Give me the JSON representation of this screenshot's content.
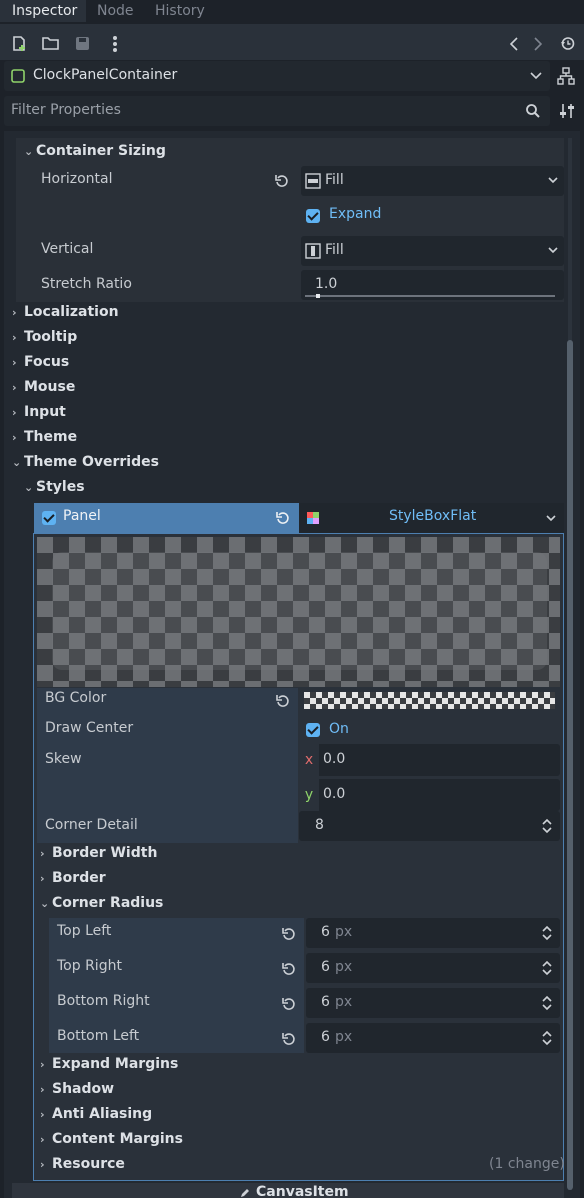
{
  "tabs": [
    {
      "label": "Inspector",
      "active": true
    },
    {
      "label": "Node",
      "active": false
    },
    {
      "label": "History",
      "active": false
    }
  ],
  "node_selector": {
    "value": "ClockPanelContainer"
  },
  "filter": {
    "placeholder": "Filter Properties"
  },
  "container_sizing": {
    "title": "Container Sizing",
    "horizontal_label": "Horizontal",
    "horizontal_value": "Fill",
    "expand_label": "Expand",
    "vertical_label": "Vertical",
    "vertical_value": "Fill",
    "stretch_label": "Stretch Ratio",
    "stretch_value": "1.0"
  },
  "sections": {
    "localization": "Localization",
    "tooltip": "Tooltip",
    "focus": "Focus",
    "mouse": "Mouse",
    "input": "Input",
    "theme": "Theme",
    "theme_overrides": "Theme Overrides",
    "styles": "Styles"
  },
  "panel": {
    "label": "Panel",
    "resource": "StyleBoxFlat"
  },
  "stylebox": {
    "bg_color_label": "BG Color",
    "draw_center_label": "Draw Center",
    "draw_center_value": "On",
    "skew_label": "Skew",
    "skew_x_axis": "x",
    "skew_x": "0.0",
    "skew_y_axis": "y",
    "skew_y": "0.0",
    "corner_detail_label": "Corner Detail",
    "corner_detail": "8",
    "border_width": "Border Width",
    "border": "Border",
    "corner_radius": "Corner Radius",
    "top_left_label": "Top Left",
    "top_left": "6",
    "top_right_label": "Top Right",
    "top_right": "6",
    "bottom_right_label": "Bottom Right",
    "bottom_right": "6",
    "bottom_left_label": "Bottom Left",
    "bottom_left": "6",
    "unit": "px",
    "expand_margins": "Expand Margins",
    "shadow": "Shadow",
    "anti_aliasing": "Anti Aliasing",
    "content_margins": "Content Margins",
    "resource": "Resource",
    "resource_changes": "(1 change)"
  },
  "footer": {
    "label": "CanvasItem"
  },
  "colors": {
    "accent": "#5eb2f2",
    "panel_header": "#4d7fb0",
    "background": "#1d2229"
  }
}
